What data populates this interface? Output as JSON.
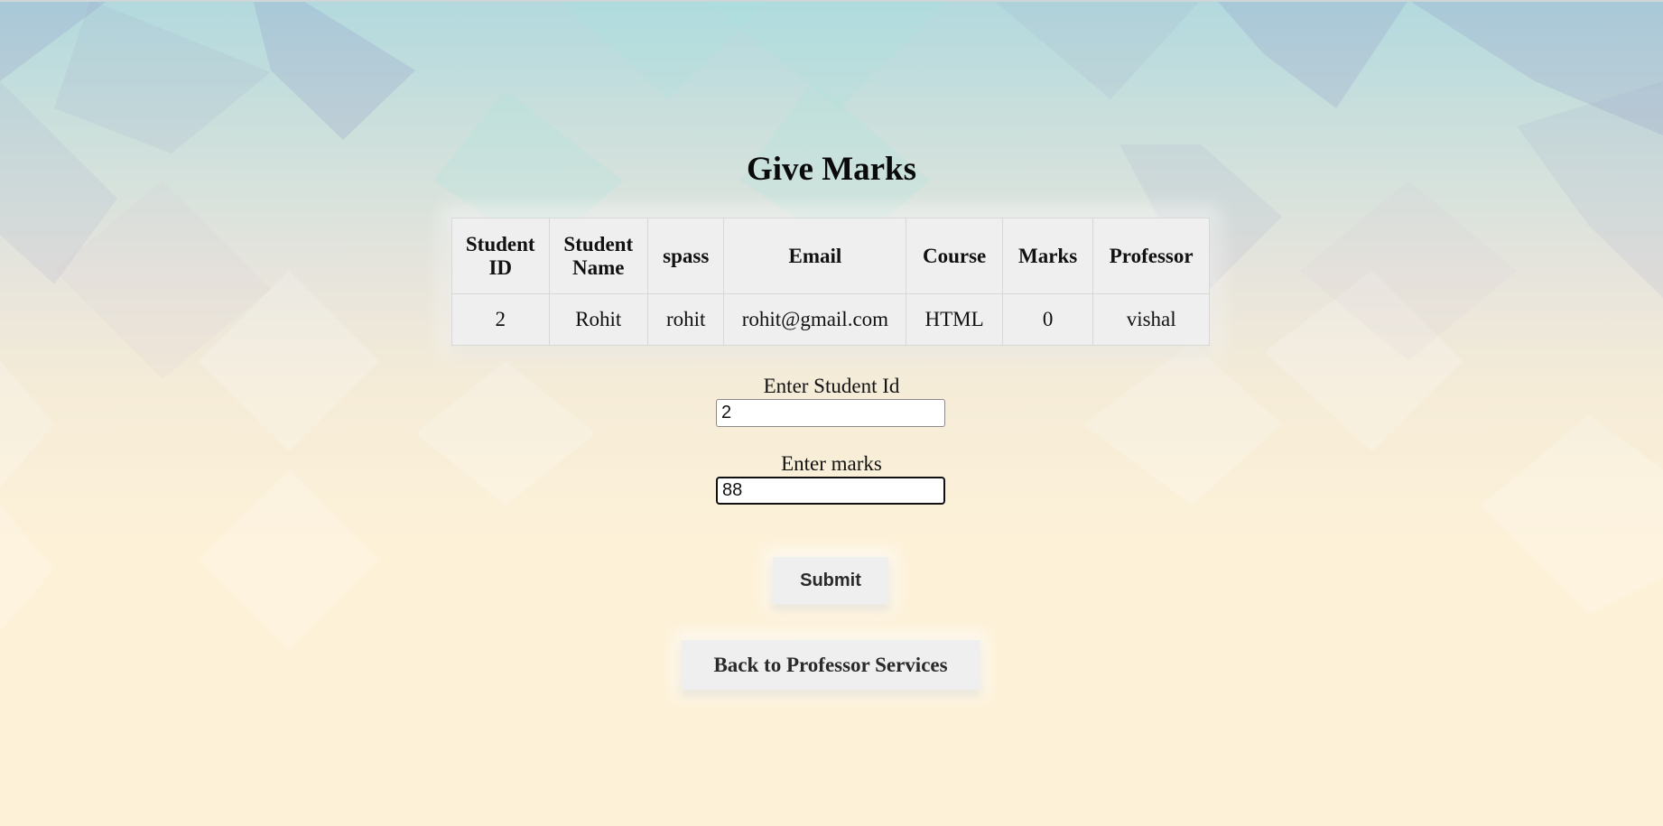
{
  "page": {
    "title": "Give Marks"
  },
  "table": {
    "headers": [
      "Student ID",
      "Student Name",
      "spass",
      "Email",
      "Course",
      "Marks",
      "Professor"
    ],
    "rows": [
      [
        "2",
        "Rohit",
        "rohit",
        "rohit@gmail.com",
        "HTML",
        "0",
        "vishal"
      ]
    ]
  },
  "form": {
    "student_id_label": "Enter Student Id",
    "student_id_value": "2",
    "marks_label": "Enter marks",
    "marks_value": "88",
    "submit_label": "Submit"
  },
  "nav": {
    "back_label": "Back to Professor Services"
  },
  "colors": {
    "background_top": "#b2d9de",
    "background_bottom": "#fdf1d7",
    "button_bg": "#efefef",
    "table_bg": "#efefef"
  }
}
